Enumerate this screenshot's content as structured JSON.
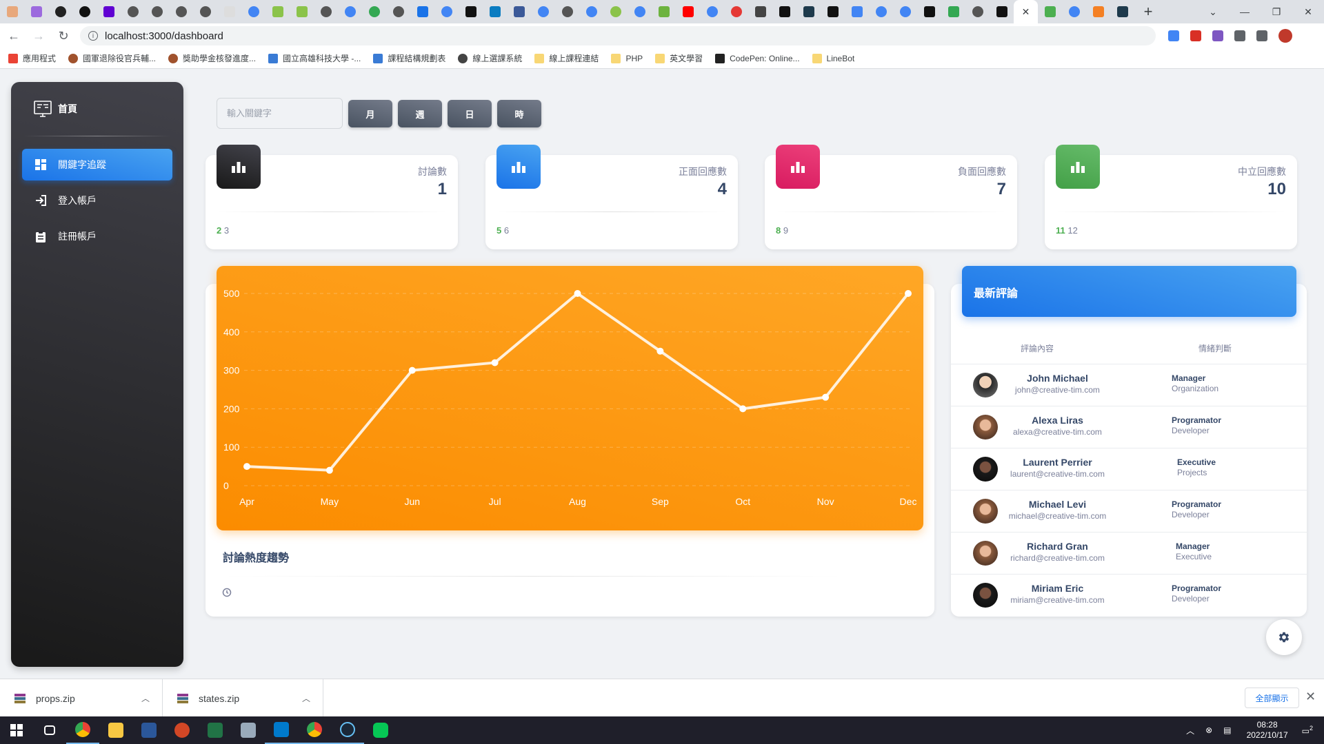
{
  "browser": {
    "url": "localhost:3000/dashboard",
    "bookmarks": [
      "應用程式",
      "國軍退除役官兵輔...",
      "獎助學金核發進度...",
      "國立高雄科技大學 -...",
      "課程結構規劃表",
      "線上選課系統",
      "線上課程連結",
      "PHP",
      "英文學習",
      "CodePen: Online...",
      "LineBot"
    ]
  },
  "sidebar": {
    "brand": "首頁",
    "items": [
      {
        "label": "關鍵字追蹤",
        "icon": "dashboard-icon"
      },
      {
        "label": "登入帳戶",
        "icon": "login-icon"
      },
      {
        "label": "註冊帳戶",
        "icon": "clipboard-icon"
      }
    ]
  },
  "filters": {
    "search_placeholder": "輸入關鍵字",
    "month": "月",
    "week": "週",
    "day": "日",
    "hour": "時"
  },
  "stats": [
    {
      "label": "討論數",
      "value": "1",
      "foot_a": "2",
      "foot_b": "3",
      "color": "#262626"
    },
    {
      "label": "正面回應數",
      "value": "4",
      "foot_a": "5",
      "foot_b": "6",
      "color": "#1a73e8"
    },
    {
      "label": "負面回應數",
      "value": "7",
      "foot_a": "8",
      "foot_b": "9",
      "color": "#e91e63"
    },
    {
      "label": "中立回應數",
      "value": "10",
      "foot_a": "11",
      "foot_b": "12",
      "color": "#4caf50"
    }
  ],
  "chart": {
    "title": "討論熱度趨勢"
  },
  "chart_data": {
    "type": "line",
    "categories": [
      "Apr",
      "May",
      "Jun",
      "Jul",
      "Aug",
      "Sep",
      "Oct",
      "Nov",
      "Dec"
    ],
    "values": [
      50,
      40,
      300,
      320,
      500,
      350,
      200,
      230,
      500
    ],
    "title": "",
    "xlabel": "",
    "ylabel": "",
    "ylim": [
      0,
      500
    ],
    "yticks": [
      0,
      100,
      200,
      300,
      400,
      500
    ],
    "grid": true
  },
  "comments": {
    "title": "最新評論",
    "col_content": "評論內容",
    "col_sentiment": "情緒判斷",
    "rows": [
      {
        "name": "John Michael",
        "email": "john@creative-tim.com",
        "role": "Manager",
        "org": "Organization"
      },
      {
        "name": "Alexa Liras",
        "email": "alexa@creative-tim.com",
        "role": "Programator",
        "org": "Developer"
      },
      {
        "name": "Laurent Perrier",
        "email": "laurent@creative-tim.com",
        "role": "Executive",
        "org": "Projects"
      },
      {
        "name": "Michael Levi",
        "email": "michael@creative-tim.com",
        "role": "Programator",
        "org": "Developer"
      },
      {
        "name": "Richard Gran",
        "email": "richard@creative-tim.com",
        "role": "Manager",
        "org": "Executive"
      },
      {
        "name": "Miriam Eric",
        "email": "miriam@creative-tim.com",
        "role": "Programator",
        "org": "Developer"
      }
    ]
  },
  "downloads": {
    "file1": "props.zip",
    "file2": "states.zip",
    "show_all": "全部顯示"
  },
  "taskbar": {
    "time": "08:28",
    "date": "2022/10/17",
    "notifications": "2"
  }
}
